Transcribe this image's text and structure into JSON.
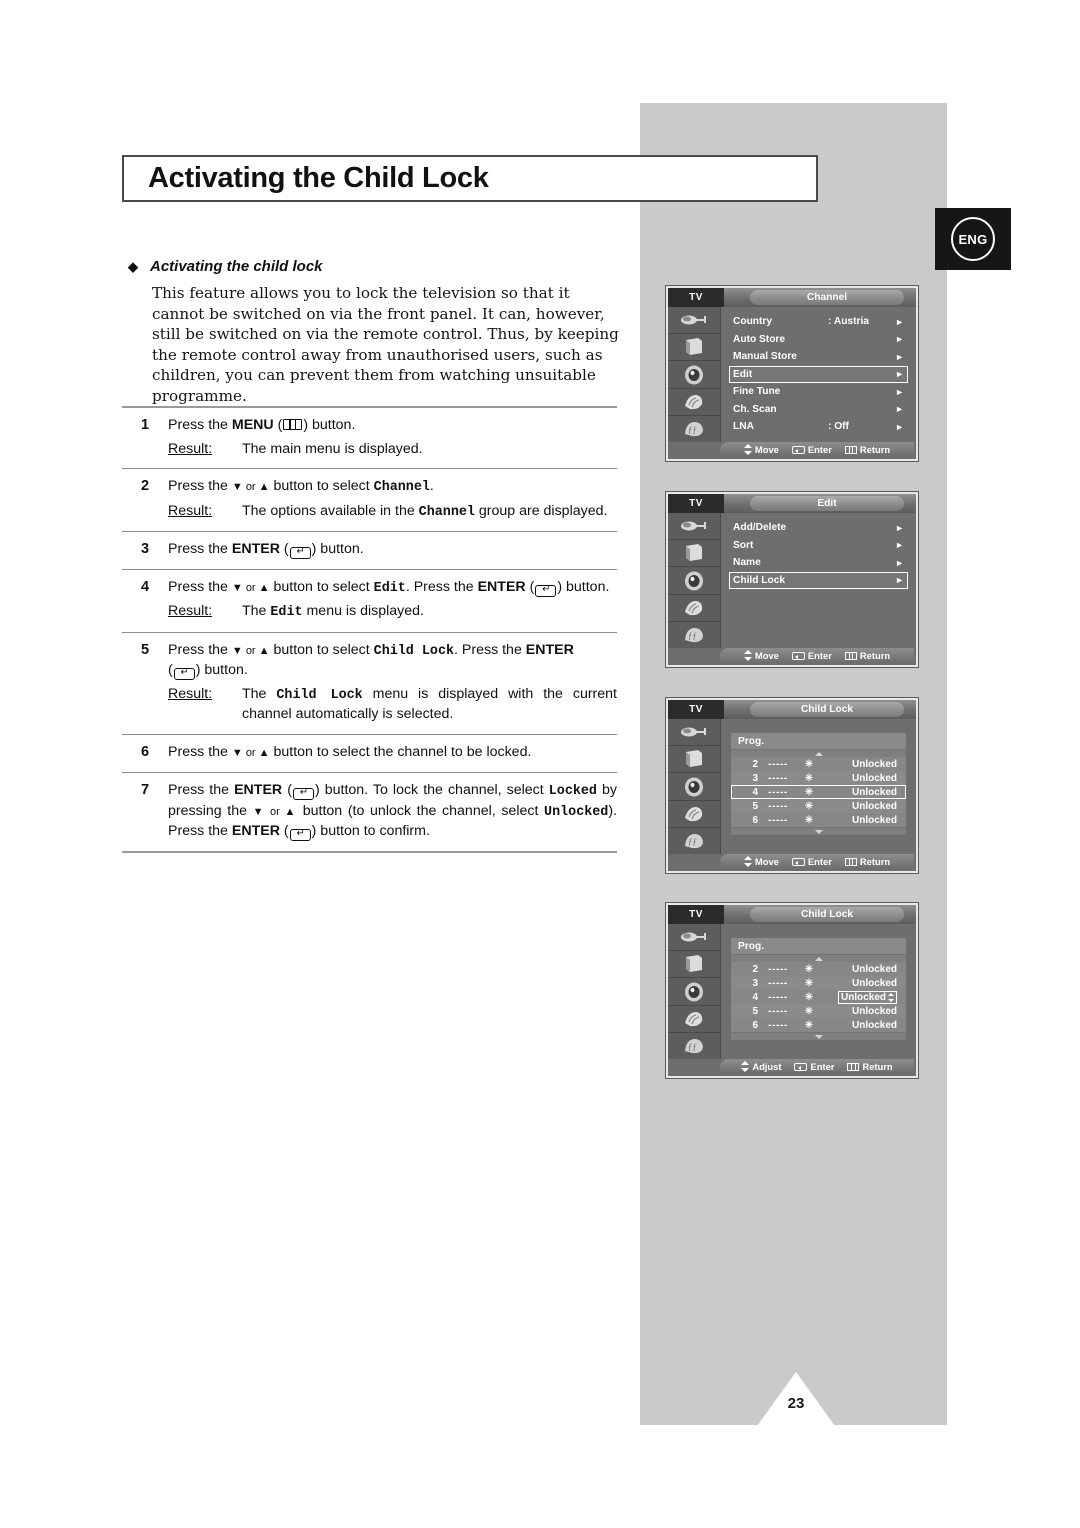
{
  "page": {
    "title": "Activating the Child Lock",
    "language_badge": "ENG",
    "page_number": "23"
  },
  "section": {
    "heading": "Activating the child lock",
    "body": "This feature allows you to lock the television so that it cannot be switched on via the front panel. It can, however, still be switched on via the remote control. Thus, by keeping the remote control away from unauthorised users, such as children, you can prevent them from watching unsuitable programme."
  },
  "steps": [
    {
      "number": "1",
      "instruction_pre": "Press the ",
      "instruction_bold": "MENU",
      "instruction_mid": " (",
      "icon": "menu-icon",
      "instruction_post": ") button.",
      "result_label": "Result:",
      "result_text": "The main menu is displayed."
    },
    {
      "number": "2",
      "instruction_pre": "Press the ",
      "arrows": "▼ or ▲",
      "instruction_mid": " button to select ",
      "target": "Channel",
      "instruction_post": ".",
      "result_label": "Result:",
      "result_pre": "The options available in the ",
      "result_target": "Channel",
      "result_post": " group are displayed."
    },
    {
      "number": "3",
      "instruction_pre": "Press the ",
      "instruction_bold": "ENTER",
      "instruction_mid": " (",
      "icon": "enter-icon",
      "instruction_post": ") button."
    },
    {
      "number": "4",
      "instruction_pre": "Press the ",
      "arrows": "▼ or ▲",
      "instruction_mid": " button to select ",
      "target": "Edit",
      "instruction_mid2": ". Press the ",
      "instruction_bold": "ENTER",
      "instruction_post": ") button.",
      "result_label": "Result:",
      "result_pre": "The ",
      "result_target": "Edit",
      "result_post": " menu is displayed."
    },
    {
      "number": "5",
      "instruction_pre": "Press the ",
      "arrows": "▼ or ▲",
      "instruction_mid": " button to select ",
      "target": "Child Lock",
      "instruction_mid2": ". Press the ",
      "instruction_bold": "ENTER",
      "instruction_post": ") button.",
      "result_label": "Result:",
      "result_pre": "The ",
      "result_target": "Child Lock",
      "result_post": " menu is displayed with the current channel automatically is selected."
    },
    {
      "number": "6",
      "instruction_pre": "Press the ",
      "arrows": "▼ or ▲",
      "instruction_mid": " button to select the channel to be locked.",
      "target": "",
      "instruction_post": ""
    },
    {
      "number": "7",
      "instruction_pre": "Press the ",
      "instruction_bold": "ENTER",
      "instruction_post": ") button. To lock the channel, select ",
      "locked_word": "Locked",
      "seg2": " by pressing the ",
      "arrows": "▼ or ▲",
      "seg3": " button (to unlock the channel, select ",
      "unlocked_word": "Unlocked",
      "seg4": "). Press the ",
      "enter_word": "ENTER",
      "seg5": ") button to confirm."
    }
  ],
  "osd_menus": [
    {
      "tv_label": "TV",
      "title": "Channel",
      "rows": [
        {
          "label": "Country",
          "value": ": Austria",
          "caret": "►",
          "selected": false
        },
        {
          "label": "Auto Store",
          "value": "",
          "caret": "►",
          "selected": false
        },
        {
          "label": "Manual Store",
          "value": "",
          "caret": "►",
          "selected": false
        },
        {
          "label": "Edit",
          "value": "",
          "caret": "►",
          "selected": true
        },
        {
          "label": "Fine Tune",
          "value": "",
          "caret": "►",
          "selected": false
        },
        {
          "label": "Ch. Scan",
          "value": "",
          "caret": "►",
          "selected": false
        },
        {
          "label": "LNA",
          "value": ": Off",
          "caret": "►",
          "selected": false
        }
      ],
      "footer": {
        "move": "Move",
        "enter": "Enter",
        "return": "Return"
      }
    },
    {
      "tv_label": "TV",
      "title": "Edit",
      "rows": [
        {
          "label": "Add/Delete",
          "value": "",
          "caret": "►",
          "selected": false
        },
        {
          "label": "Sort",
          "value": "",
          "caret": "►",
          "selected": false
        },
        {
          "label": "Name",
          "value": "",
          "caret": "►",
          "selected": false
        },
        {
          "label": "Child Lock",
          "value": "",
          "caret": "►",
          "selected": true
        }
      ],
      "footer": {
        "move": "Move",
        "enter": "Enter",
        "return": "Return"
      }
    },
    {
      "tv_label": "TV",
      "title": "Child Lock",
      "table_header": "Prog.",
      "rows": [
        {
          "prog": "2",
          "dash": "-----",
          "star": "✳",
          "state": "Unlocked",
          "selected": false,
          "value_boxed": false
        },
        {
          "prog": "3",
          "dash": "-----",
          "star": "✳",
          "state": "Unlocked",
          "selected": false,
          "value_boxed": false
        },
        {
          "prog": "4",
          "dash": "-----",
          "star": "✳",
          "state": "Unlocked",
          "selected": true,
          "value_boxed": false
        },
        {
          "prog": "5",
          "dash": "-----",
          "star": "✳",
          "state": "Unlocked",
          "selected": false,
          "value_boxed": false
        },
        {
          "prog": "6",
          "dash": "-----",
          "star": "✳",
          "state": "Unlocked",
          "selected": false,
          "value_boxed": false
        }
      ],
      "footer": {
        "move": "Move",
        "enter": "Enter",
        "return": "Return"
      }
    },
    {
      "tv_label": "TV",
      "title": "Child Lock",
      "table_header": "Prog.",
      "rows": [
        {
          "prog": "2",
          "dash": "-----",
          "star": "✳",
          "state": "Unlocked",
          "selected": false,
          "value_boxed": false
        },
        {
          "prog": "3",
          "dash": "-----",
          "star": "✳",
          "state": "Unlocked",
          "selected": false,
          "value_boxed": false
        },
        {
          "prog": "4",
          "dash": "-----",
          "star": "✳",
          "state": "Unlocked",
          "selected": false,
          "value_boxed": true
        },
        {
          "prog": "5",
          "dash": "-----",
          "star": "✳",
          "state": "Unlocked",
          "selected": false,
          "value_boxed": false
        },
        {
          "prog": "6",
          "dash": "-----",
          "star": "✳",
          "state": "Unlocked",
          "selected": false,
          "value_boxed": false
        }
      ],
      "footer": {
        "move": "Adjust",
        "enter": "Enter",
        "return": "Return"
      }
    }
  ],
  "colors": {
    "band_gray": "#cacaca",
    "osd_bg": "#6e6e6e",
    "osd_panel": "#8a8a8a",
    "badge_bg": "#161616"
  }
}
